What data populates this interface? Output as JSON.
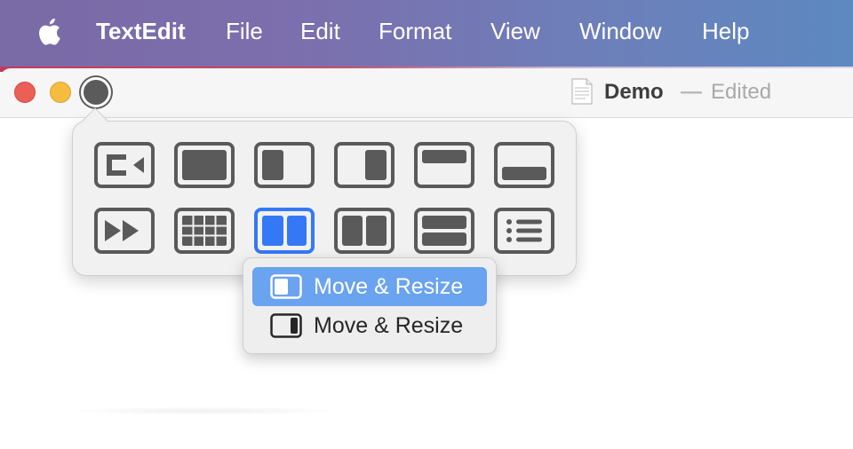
{
  "menubar": {
    "apple_icon": "apple-logo-icon",
    "app_name": "TextEdit",
    "items": [
      "File",
      "Edit",
      "Format",
      "View",
      "Window",
      "Help"
    ]
  },
  "window": {
    "title": "Demo",
    "separator": "—",
    "status": "Edited",
    "doc_icon": "document-icon"
  },
  "tile_panel": {
    "rows": [
      [
        "move-to-display-icon",
        "fill-icon",
        "left-half-icon",
        "right-half-icon",
        "top-half-icon",
        "bottom-half-icon"
      ],
      [
        "fast-forward-icon",
        "grid-icon",
        "split-left-right-icon",
        "split-vertical-icon",
        "split-horizontal-icon",
        "list-icon"
      ]
    ],
    "active_tile": "split-left-right-icon"
  },
  "submenu": {
    "items": [
      {
        "label": "Move & Resize",
        "icon": "left-side-window-icon",
        "highlighted": true
      },
      {
        "label": "Move & Resize",
        "icon": "right-side-window-icon",
        "highlighted": false
      }
    ]
  },
  "colors": {
    "accent": "#3478f6",
    "highlight": "#6aa3ef",
    "close": "#ec5f57",
    "minimize": "#f5bd3f",
    "icon_gray": "#5a5a5a"
  }
}
